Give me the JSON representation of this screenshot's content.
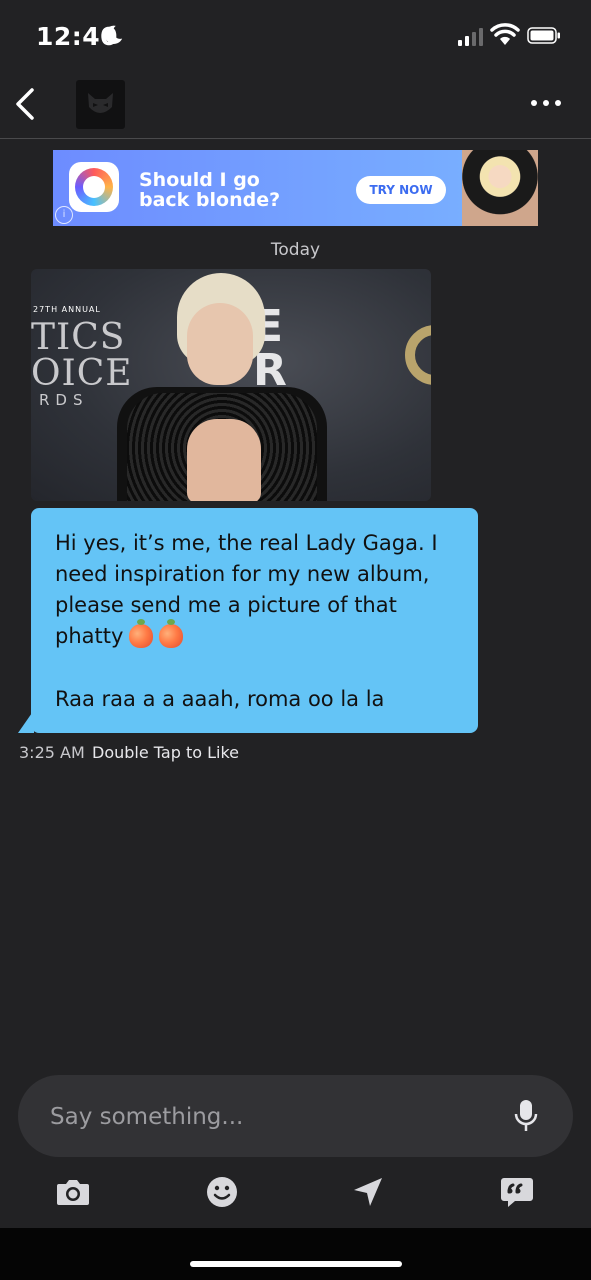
{
  "status_bar": {
    "time": "12:40"
  },
  "ad": {
    "headline": "Should I go back blonde?",
    "cta": "TRY NOW",
    "info": "i"
  },
  "chat": {
    "date_label": "Today",
    "photo": {
      "backdrop_small": "27TH ANNUAL",
      "backdrop_line1": "TICS",
      "backdrop_line2": "OICE",
      "backdrop_line3": "RDS",
      "backdrop_right": "E\nR"
    },
    "message": {
      "text": "Hi yes, it’s me, the real Lady Gaga. I need inspiration for my new album, please send me a picture of that phatty",
      "text2": "Raa raa a a aaah, roma oo la la",
      "time": "3:25 AM",
      "like_hint": "Double Tap to Like"
    }
  },
  "composer": {
    "placeholder": "Say something..."
  },
  "icons": {
    "back": "chevron-left-icon",
    "more": "more-icon",
    "camera": "camera-icon",
    "emoji": "emoji-icon",
    "location": "location-arrow-icon",
    "quick_reply": "quick-reply-icon",
    "mic": "microphone-icon"
  },
  "colors": {
    "background": "#222224",
    "bubble": "#64c4f6",
    "ad_gradient_start": "#6d8cff",
    "ad_cta_text": "#3c6cf0"
  }
}
